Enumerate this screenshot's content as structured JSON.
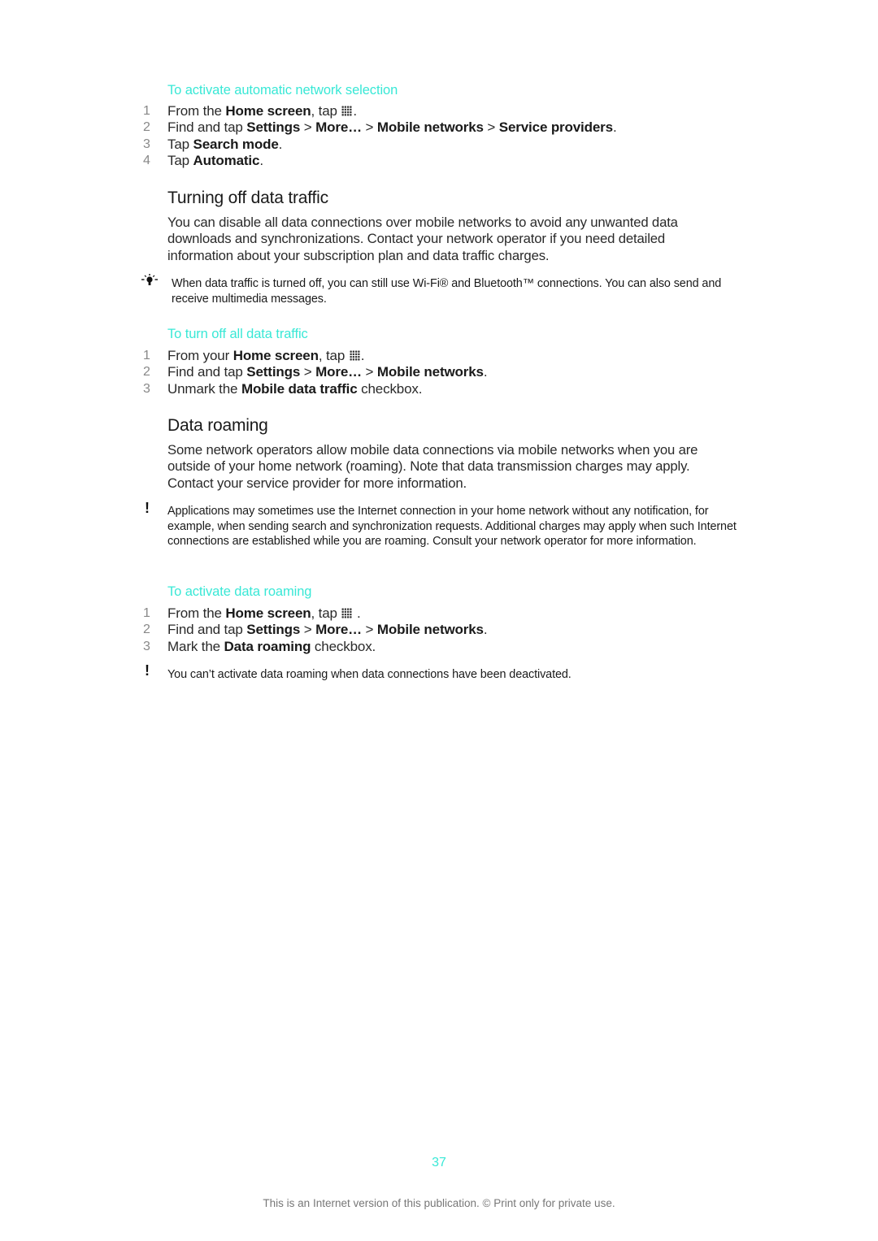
{
  "sections": {
    "auto_network": {
      "title": "To activate automatic network selection",
      "steps": [
        {
          "num": "1",
          "pre": "From the ",
          "b1": "Home screen",
          "post": ", tap ",
          "icon": "apps-grid-icon",
          "end": "."
        },
        {
          "num": "2",
          "pre": "Find and tap ",
          "b1": "Settings",
          "s1": " > ",
          "b2": "More…",
          "s2": " > ",
          "b3": "Mobile networks",
          "s3": " > ",
          "b4": "Service providers",
          "end": "."
        },
        {
          "num": "3",
          "pre": "Tap ",
          "b1": "Search mode",
          "end": "."
        },
        {
          "num": "4",
          "pre": "Tap ",
          "b1": "Automatic",
          "end": "."
        }
      ]
    },
    "turning_off": {
      "heading": "Turning off data traffic",
      "paragraph": "You can disable all data connections over mobile networks to avoid any unwanted data downloads and synchronizations. Contact your network operator if you need detailed information about your subscription plan and data traffic charges.",
      "tip_icon": "lightbulb-tip-icon",
      "tip": "When data traffic is turned off, you can still use Wi-Fi® and Bluetooth™ connections. You can also send and receive multimedia messages."
    },
    "turn_off_all": {
      "title": "To turn off all data traffic",
      "steps": [
        {
          "num": "1",
          "pre": "From your ",
          "b1": "Home screen",
          "post": ", tap ",
          "icon": "apps-grid-icon",
          "end": "."
        },
        {
          "num": "2",
          "pre": "Find and tap ",
          "b1": "Settings",
          "s1": " > ",
          "b2": "More…",
          "s2": " > ",
          "b3": "Mobile networks",
          "end": "."
        },
        {
          "num": "3",
          "pre": "Unmark the ",
          "b1": "Mobile data traffic",
          "end": " checkbox."
        }
      ]
    },
    "data_roaming": {
      "heading": "Data roaming",
      "paragraph": "Some network operators allow mobile data connections via mobile networks when you are outside of your home network (roaming). Note that data transmission charges may apply. Contact your service provider for more information.",
      "warning_icon": "exclamation-warning-icon",
      "warning": "Applications may sometimes use the Internet connection in your home network without any notification, for example, when sending search and synchronization requests. Additional charges may apply when such Internet connections are established while you are roaming. Consult your network operator for more information."
    },
    "activate_roaming": {
      "title": "To activate data roaming",
      "steps": [
        {
          "num": "1",
          "pre": "From the ",
          "b1": "Home screen",
          "post": ", tap ",
          "icon": "apps-grid-icon",
          "end": " ."
        },
        {
          "num": "2",
          "pre": "Find and tap ",
          "b1": "Settings",
          "s1": " > ",
          "b2": "More…",
          "s2": " > ",
          "b3": "Mobile networks",
          "end": "."
        },
        {
          "num": "3",
          "pre": "Mark the ",
          "b1": "Data roaming",
          "end": " checkbox."
        }
      ],
      "warning": "You can’t activate data roaming when data connections have been deactivated."
    }
  },
  "page_number": "37",
  "footer": "This is an Internet version of this publication. © Print only for private use.",
  "colors": {
    "accent": "#39e8d6",
    "text": "#1a1a1a",
    "muted": "#777777"
  }
}
